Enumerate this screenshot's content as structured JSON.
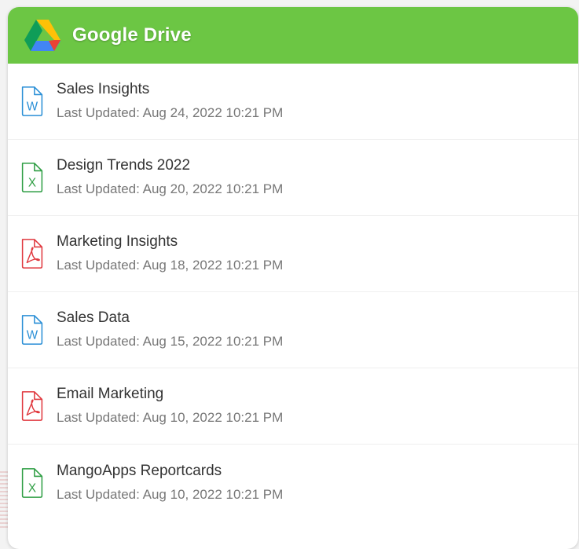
{
  "header": {
    "title": "Google Drive",
    "logo_icon": "google-drive-icon",
    "background": "#6cc644"
  },
  "files": [
    {
      "name": "Sales Insights",
      "updated": "Last Updated: Aug 24, 2022 10:21 PM",
      "type": "word",
      "icon": "word-document-icon",
      "color": "#2a8fd6"
    },
    {
      "name": "Design Trends 2022",
      "updated": "Last Updated: Aug 20, 2022 10:21 PM",
      "type": "excel",
      "icon": "excel-spreadsheet-icon",
      "color": "#2f9e44"
    },
    {
      "name": "Marketing Insights",
      "updated": "Last Updated: Aug 18, 2022 10:21 PM",
      "type": "pdf",
      "icon": "pdf-document-icon",
      "color": "#e0383e"
    },
    {
      "name": "Sales Data",
      "updated": "Last Updated: Aug 15, 2022 10:21 PM",
      "type": "word",
      "icon": "word-document-icon",
      "color": "#2a8fd6"
    },
    {
      "name": "Email Marketing",
      "updated": "Last Updated: Aug 10, 2022 10:21 PM",
      "type": "pdf",
      "icon": "pdf-document-icon",
      "color": "#e0383e"
    },
    {
      "name": "MangoApps Reportcards",
      "updated": "Last Updated: Aug 10, 2022 10:21 PM",
      "type": "excel",
      "icon": "excel-spreadsheet-icon",
      "color": "#2f9e44"
    }
  ]
}
